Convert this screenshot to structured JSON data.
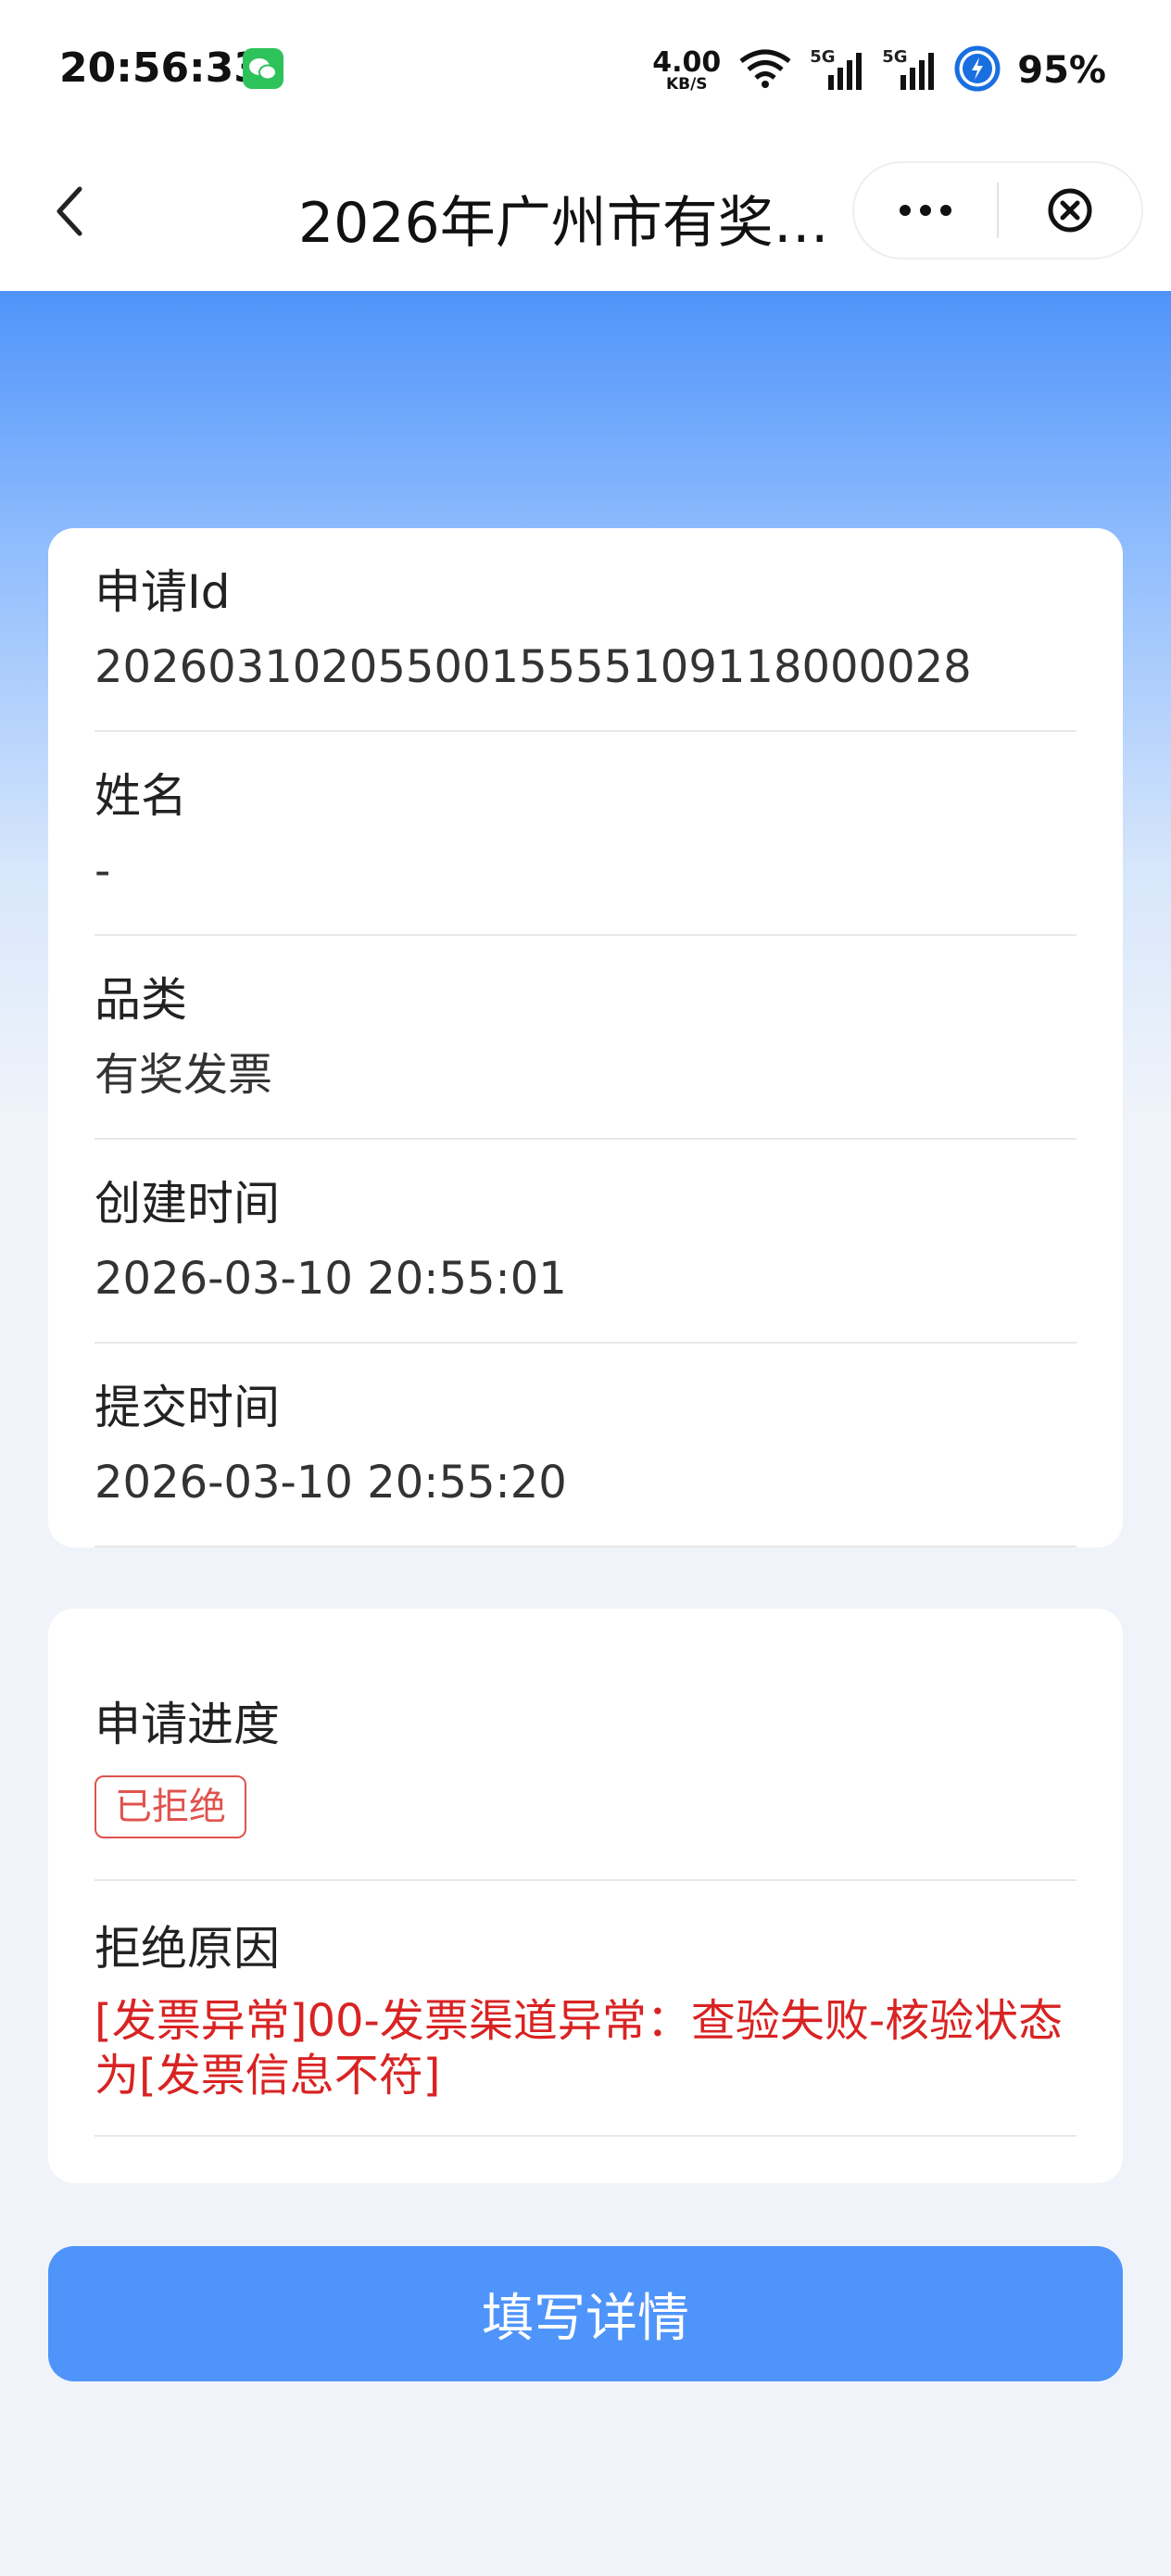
{
  "status_bar": {
    "time": "20:56:33",
    "net_speed_value": "4.00",
    "net_speed_unit": "KB/S",
    "signal_1_label": "5G",
    "signal_2_label": "5G",
    "battery": "95%"
  },
  "title_bar": {
    "title": "2026年广州市有奖发…"
  },
  "info": {
    "application_id_label": "申请Id",
    "application_id_value": "202603102055001555510911800​0028",
    "name_label": "姓名",
    "name_value": "-",
    "category_label": "品类",
    "category_value": "有奖发票",
    "created_label": "创建时间",
    "created_value": "2026-03-10 20:55:01",
    "submitted_label": "提交时间",
    "submitted_value": "2026-03-10 20:55:20"
  },
  "progress": {
    "progress_label": "申请进度",
    "status": "已拒绝",
    "status_color": "#e0534e",
    "reason_label": "拒绝原因",
    "reason_text": "[发票异常]00-发票渠道异常：查验失败-核验状态为[发票信息不符]",
    "reason_color": "#d92323"
  },
  "actions": {
    "fill_details_label": "填写详情"
  },
  "colors": {
    "primary": "#4f94fa",
    "background": "#f0f4fa"
  },
  "icons": {
    "back": "chevron-left-icon",
    "more": "more-dots-icon",
    "close": "close-circle-icon",
    "wifi": "wifi-icon",
    "signal": "signal-bars-icon",
    "battery": "battery-charging-icon",
    "wechat": "wechat-icon"
  }
}
